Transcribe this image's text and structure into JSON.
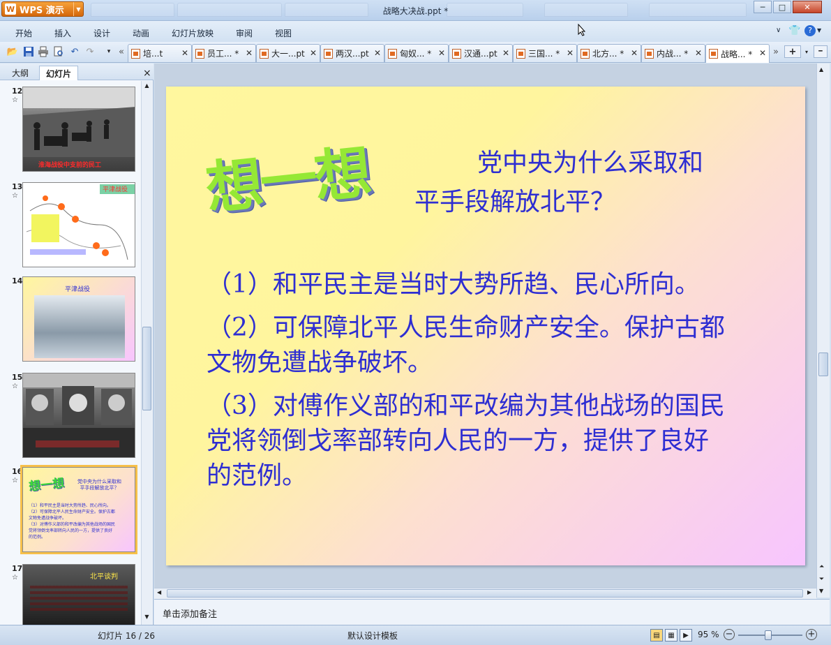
{
  "app": {
    "name": "WPS 演示",
    "logo": "W"
  },
  "window": {
    "title": "战略大决战.ppt *",
    "minimize": "─",
    "maximize": "□",
    "close": "✕"
  },
  "menu": [
    "开始",
    "插入",
    "设计",
    "动画",
    "幻灯片放映",
    "审阅",
    "视图"
  ],
  "tabs": [
    {
      "label": "培...t",
      "modified": false
    },
    {
      "label": "员工... *",
      "modified": true
    },
    {
      "label": "大一...pt",
      "modified": false
    },
    {
      "label": "两汉...pt",
      "modified": false
    },
    {
      "label": "匈奴... *",
      "modified": true
    },
    {
      "label": "汉通...pt",
      "modified": false
    },
    {
      "label": "三国... *",
      "modified": true
    },
    {
      "label": "北方... *",
      "modified": true
    },
    {
      "label": "内战... *",
      "modified": true
    },
    {
      "label": "战略... *",
      "modified": true,
      "active": true
    }
  ],
  "left_pane": {
    "tab_outline": "大纲",
    "tab_slides": "幻灯片",
    "close": "×",
    "thumbnails": [
      {
        "number": "12",
        "caption": "淮海战役中支前的民工"
      },
      {
        "number": "13",
        "caption": "平津战役"
      },
      {
        "number": "14",
        "caption": "平津战役"
      },
      {
        "number": "15",
        "caption": ""
      },
      {
        "number": "16",
        "caption": "想一想",
        "selected": true
      },
      {
        "number": "17",
        "caption": "北平谈判"
      }
    ]
  },
  "slide": {
    "title_art": "想一想",
    "question_line1": "党中央为什么采取和",
    "question_line2": "平手段解放北平？",
    "point1": "（1）和平民主是当时大势所趋、民心所向。",
    "point2_line1": "（2）可保障北平人民生命财产安全。保护古都",
    "point2_line2": "文物免遭战争破坏。",
    "point3_line1": "（3）对傅作义部的和平改编为其他战场的国民",
    "point3_line2": "党将领倒戈率部转向人民的一方，提供了良好",
    "point3_line3": "的范例。"
  },
  "notes": {
    "placeholder": "单击添加备注"
  },
  "status": {
    "slide_counter": "幻灯片 16 / 26",
    "template": "默认设计模板",
    "zoom": "95 %"
  }
}
